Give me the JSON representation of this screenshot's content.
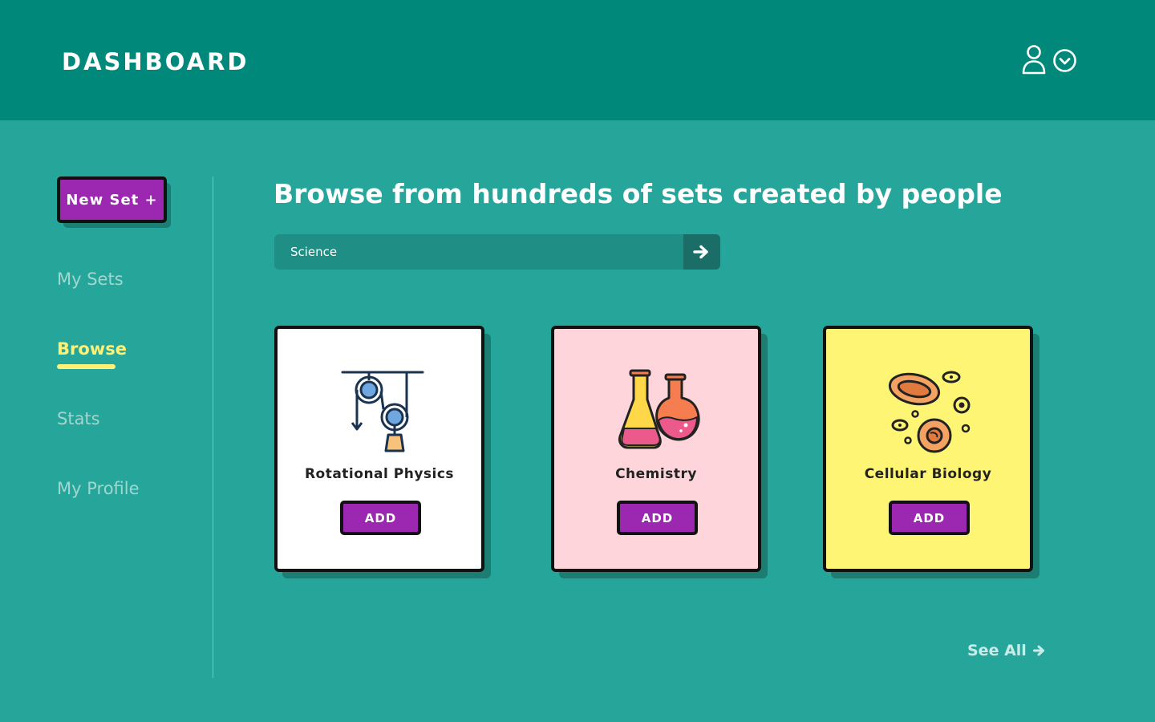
{
  "header": {
    "title": "DASHBOARD",
    "icons": {
      "user": "user-icon",
      "dropdown": "chevron-down-circle-icon"
    }
  },
  "sidebar": {
    "new_set_label": "New Set +",
    "items": [
      {
        "label": "My Sets",
        "active": false
      },
      {
        "label": "Browse",
        "active": true
      },
      {
        "label": "Stats",
        "active": false
      },
      {
        "label": "My Profile",
        "active": false
      }
    ]
  },
  "main": {
    "heading": "Browse from hundreds of sets created by people",
    "search": {
      "value": "Science",
      "placeholder": "",
      "button_icon": "arrow-right-icon"
    },
    "cards": [
      {
        "title": "Rotational Physics",
        "icon": "pulley-icon",
        "background": "#ffffff",
        "add_label": "ADD"
      },
      {
        "title": "Chemistry",
        "icon": "flasks-icon",
        "background": "#ffd5dc",
        "add_label": "ADD"
      },
      {
        "title": "Cellular Biology",
        "icon": "cells-icon",
        "background": "#fff574",
        "add_label": "ADD"
      }
    ],
    "see_all_label": "See All",
    "see_all_icon": "arrow-right-icon"
  },
  "colors": {
    "header_bg": "#00897b",
    "page_bg": "#26a69a",
    "accent_purple": "#9c27b0",
    "active_nav": "#fff176"
  }
}
